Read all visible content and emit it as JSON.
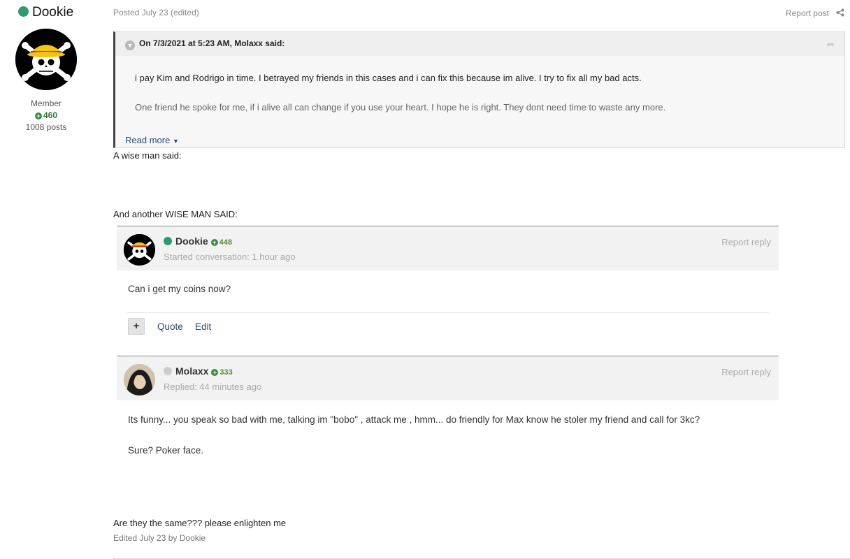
{
  "author": {
    "name": "Dookie",
    "status_color": "#2e9a6e"
  },
  "profile": {
    "rank": "Member",
    "reputation": "460",
    "posts": "1008 posts"
  },
  "post": {
    "posted": "Posted July 23 (edited)",
    "report": "Report post"
  },
  "quote": {
    "header": "On 7/3/2021 at 5:23 AM, Molaxx said:",
    "line1": "i pay Kim and Rodrigo in time. I betrayed my friends in this cases and i can fix this because im alive.  I try to fix all my bad acts.",
    "line2": "One friend  he spoke for me, if i alive all can change if you use your heart. I hope he is right. They dont need time to waste any more.",
    "read_more": "Read more"
  },
  "body": {
    "wise": "A wise man said:",
    "another": "And another WISE MAN SAID:",
    "closing": "Are they the same??? please enlighten me",
    "edited": "Edited July 23 by Dookie"
  },
  "embed1": {
    "name": "Dookie",
    "rep": "448",
    "status_color": "#2e9a6e",
    "sub": "Started conversation: 1 hour ago",
    "report": "Report reply",
    "message": "Can i get my coins now?",
    "plus": "+",
    "quote": "Quote",
    "edit": "Edit"
  },
  "embed2": {
    "name": "Molaxx",
    "rep": "333",
    "status_color": "#cccccc",
    "sub": "Replied: 44 minutes ago",
    "report": "Report reply",
    "line1": "Its funny... you speak so bad with me, talking im \"bobo\" , attack me , hmm... do friendly for Max know he stoler my friend and call for 3kc?",
    "line2": "Sure?  Poker face."
  }
}
